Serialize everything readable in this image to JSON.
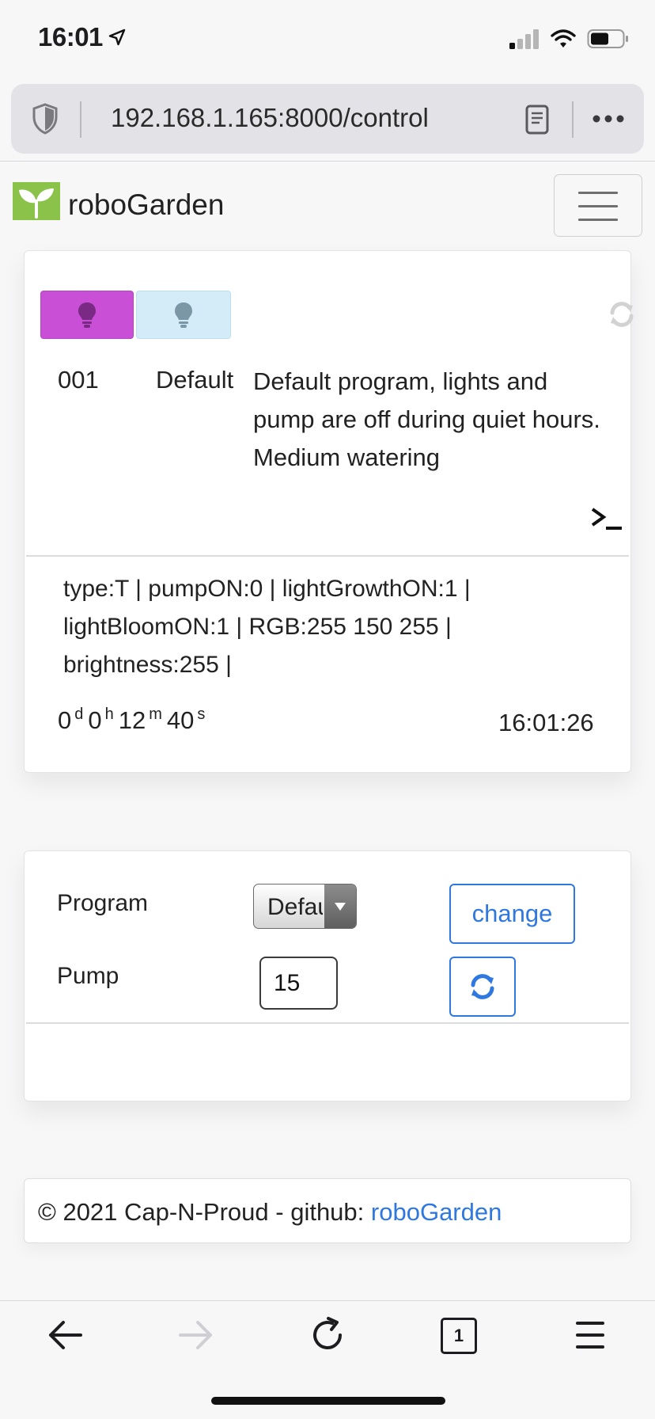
{
  "status_bar": {
    "time": "16:01"
  },
  "browser": {
    "url": "192.168.1.165:8000/control",
    "tab_count": "1"
  },
  "app": {
    "brand": "roboGarden"
  },
  "program_card": {
    "id": "001",
    "name": "Default",
    "description": "Default program, lights and pump are off during quiet hours. Medium watering",
    "status_text": "type:T | pumpON:0 | lightGrowthON:1 | lightBloomON:1 | RGB:255 150 255 | brightness:255 |",
    "uptime": {
      "d": "0",
      "d_unit": "d",
      "h": "0",
      "h_unit": "h",
      "m": "12",
      "m_unit": "m",
      "s": "40",
      "s_unit": "s"
    },
    "clock": "16:01:26",
    "growth_light_color": "#c94fd6",
    "bloom_light_color": "#d3ecf8"
  },
  "control_card": {
    "program_label": "Program",
    "program_selected": "Default",
    "change_label": "change",
    "pump_label": "Pump",
    "pump_value": "15"
  },
  "footer": {
    "text": "© 2021 Cap-N-Proud - github: ",
    "link_text": "roboGarden"
  },
  "colors": {
    "accent": "#2f78e0",
    "logo_green": "#8bc34a"
  }
}
